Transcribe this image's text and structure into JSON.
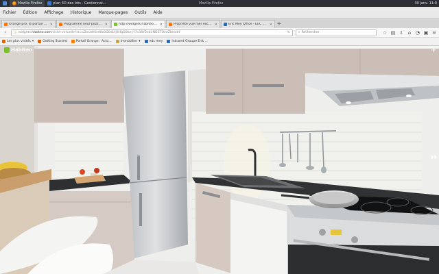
{
  "os": {
    "task_firefox": "Mozilla Firefox",
    "task_other": "plan 3D des lots - Gestionnai...",
    "window_title": "Mozilla Firefox",
    "clock": "30 janv. 11:0"
  },
  "menubar": [
    "Fichier",
    "Édition",
    "Affichage",
    "Historique",
    "Marque-pages",
    "Outils",
    "Aide"
  ],
  "tabs": [
    {
      "label": "Orange pro, le portail d'inform...",
      "color": "#ff7900",
      "active": false
    },
    {
      "label": "Programme neuf pozzo - myp...",
      "color": "#ff7900",
      "active": false
    },
    {
      "label": "http://widgets.habiteo.com/...",
      "color": "#7bbf2a",
      "active": true
    },
    {
      "label": "Propriété vue mer exception...",
      "color": "#ff7900",
      "active": false
    },
    {
      "label": "Eric Mey Office - EEC MEY A...",
      "color": "#2a6ab8",
      "active": false
    }
  ],
  "nav": {
    "url_prefix": "widgets.",
    "url_host": "habiteo.com",
    "url_rest": "/visite-virtuelle?id=U2xsdU4xd8x0D0dLYjBHqGBkeyY7v38Y2eb3NDZTOzUZbesdrf",
    "search_placeholder": "Rechercher"
  },
  "bookmarks": [
    {
      "label": "Les plus visités",
      "color": "#e66000"
    },
    {
      "label": "Getting Started",
      "color": "#e66000"
    },
    {
      "label": "Portail Orange : Actu...",
      "color": "#ff7900"
    },
    {
      "label": "Immobilier",
      "color": "#4a8a3a"
    },
    {
      "label": "edc mey",
      "color": "#2a6ab8"
    },
    {
      "label": "Intranet Groupe Erik ...",
      "color": "#2a6ab8"
    }
  ],
  "viewer": {
    "brand": "Habiteo",
    "plus": "+",
    "next_arrow": "⏵⏵"
  },
  "colors": {
    "accent_brand": "#7bbf2a",
    "cabinet": "#cdbfb8",
    "countertop": "#3a3b3d",
    "tile": "#efefea"
  }
}
